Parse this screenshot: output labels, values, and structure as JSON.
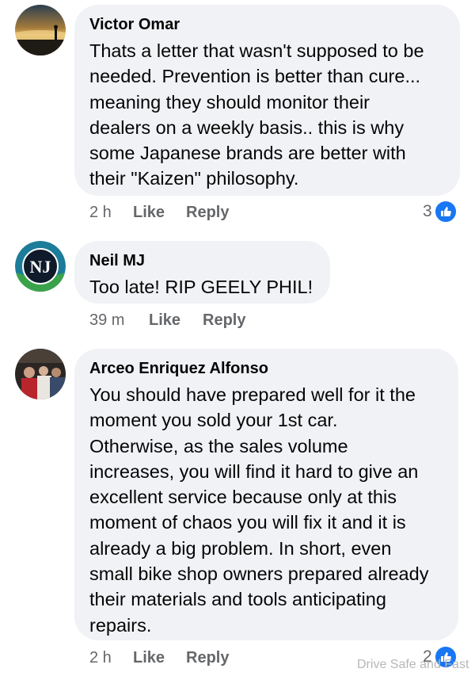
{
  "comments": [
    {
      "author": "Victor Omar",
      "text": "Thats a letter that wasn't supposed to be\nneeded. Prevention is better than cure...\nmeaning they should monitor their\ndealers on a weekly basis.. this is why\nsome Japanese brands are better with\ntheir \"Kaizen\" philosophy.",
      "time": "2 h",
      "like_label": "Like",
      "reply_label": "Reply",
      "reaction_count": "3",
      "avatar_icon": "sunset-landscape-avatar"
    },
    {
      "author": "Neil MJ",
      "text": "Too late!  RIP GEELY PHIL!",
      "time": "39 m",
      "like_label": "Like",
      "reply_label": "Reply",
      "avatar_icon": "nj-monogram-logo-avatar"
    },
    {
      "author": "Arceo Enriquez Alfonso",
      "text": "You should have prepared well for it the\nmoment you sold your 1st car.\nOtherwise, as the sales volume\nincreases, you will find it hard to give an\nexcellent service because only at this\nmoment of chaos you will fix it and it is\nalready a big problem.  In short, even\nsmall bike shop owners prepared already\ntheir materials and tools anticipating\nrepairs.",
      "time": "2 h",
      "like_label": "Like",
      "reply_label": "Reply",
      "reaction_count": "2",
      "avatar_icon": "group-photo-avatar"
    }
  ],
  "watermark": "Drive Safe and Fast",
  "colors": {
    "bubble": "#f0f2f5",
    "secondary_text": "#65676b",
    "like_blue": "#1877f2"
  }
}
